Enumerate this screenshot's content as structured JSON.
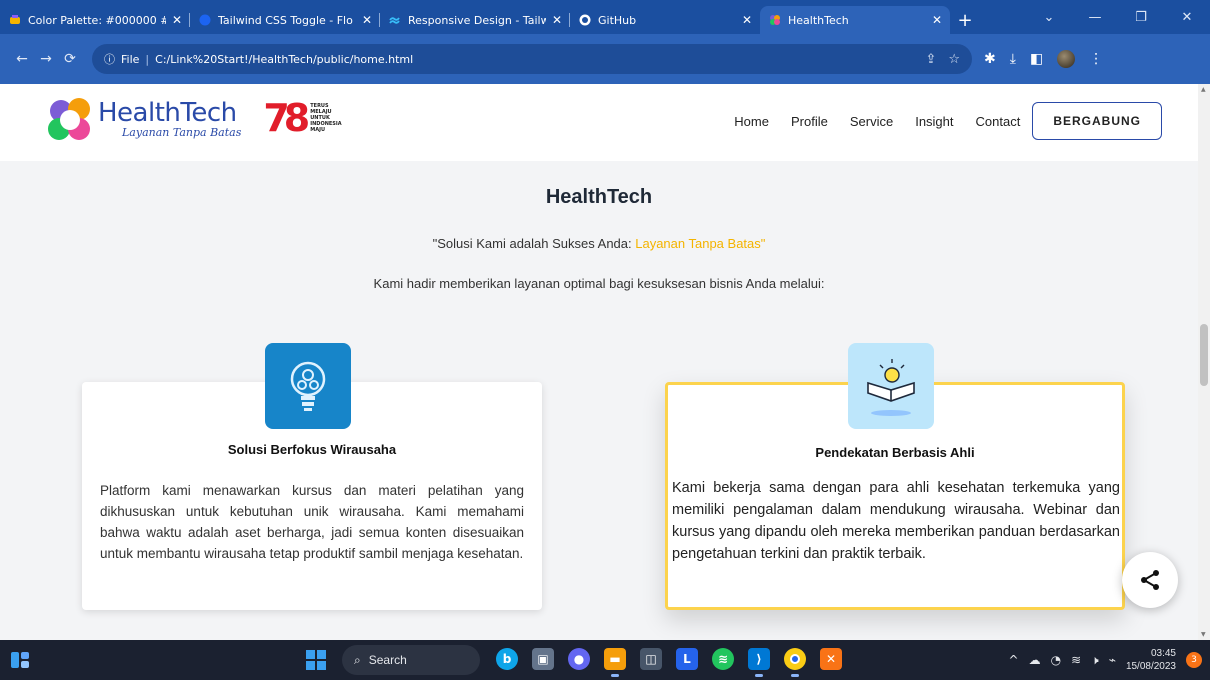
{
  "browser": {
    "tabs": [
      {
        "title": "Color Palette: #000000 #4",
        "icon": "palette-icon",
        "icon_color": "#f4b400"
      },
      {
        "title": "Tailwind CSS Toggle - Flo",
        "icon": "flowbite-icon",
        "icon_color": "#1c64f2"
      },
      {
        "title": "Responsive Design - Tailw",
        "icon": "tailwind-icon",
        "icon_color": "#38bdf8"
      },
      {
        "title": "GitHub",
        "icon": "github-icon",
        "icon_color": "#ffffff"
      },
      {
        "title": "HealthTech",
        "icon": "healthtech-icon",
        "icon_color": "#7c5cd6"
      }
    ],
    "active_tab_index": 4,
    "address": {
      "scheme_label": "File",
      "url": "C:/Link%20Start!/HealthTech/public/home.html"
    }
  },
  "site": {
    "logo": {
      "name": "HealthTech",
      "tagline": "Layanan Tanpa Batas",
      "badge_number": "78",
      "badge_text": [
        "TERUS",
        "MELAJU",
        "UNTUK",
        "INDONESIA",
        "MAJU"
      ]
    },
    "nav": {
      "items": [
        "Home",
        "Profile",
        "Service",
        "Insight",
        "Contact"
      ],
      "cta": "BERGABUNG"
    },
    "section": {
      "heading": "HealthTech",
      "tagline_prefix": "\"Solusi Kami adalah Sukses Anda: ",
      "tagline_highlight": "Layanan Tanpa Batas\"",
      "intro": "Kami hadir memberikan layanan optimal bagi kesuksesan bisnis Anda melalui:",
      "cards": [
        {
          "icon": "lightbulb-gears-icon",
          "title": "Solusi Berfokus Wirausaha",
          "body": "Platform kami menawarkan kursus dan materi pelatihan yang dikhususkan untuk kebutuhan unik wirausaha. Kami memahami bahwa waktu adalah aset berharga, jadi semua konten disesuaikan untuk membantu wirausaha tetap produktif sambil menjaga kesehatan."
        },
        {
          "icon": "book-idea-icon",
          "title": "Pendekatan Berbasis Ahli",
          "body": "Kami bekerja sama dengan para ahli kesehatan terkemuka yang memiliki pengalaman dalam mendukung wirausaha. Webinar dan kursus yang dipandu oleh mereka memberikan panduan berdasarkan pengetahuan terkini dan praktik terbaik."
        }
      ]
    },
    "colors": {
      "brand": "#2a4aa8",
      "highlight": "#f4b400",
      "card_border_active": "#fcd34d"
    }
  },
  "taskbar": {
    "search_label": "Search",
    "time": "03:45",
    "date": "15/08/2023",
    "notifications": "3"
  }
}
